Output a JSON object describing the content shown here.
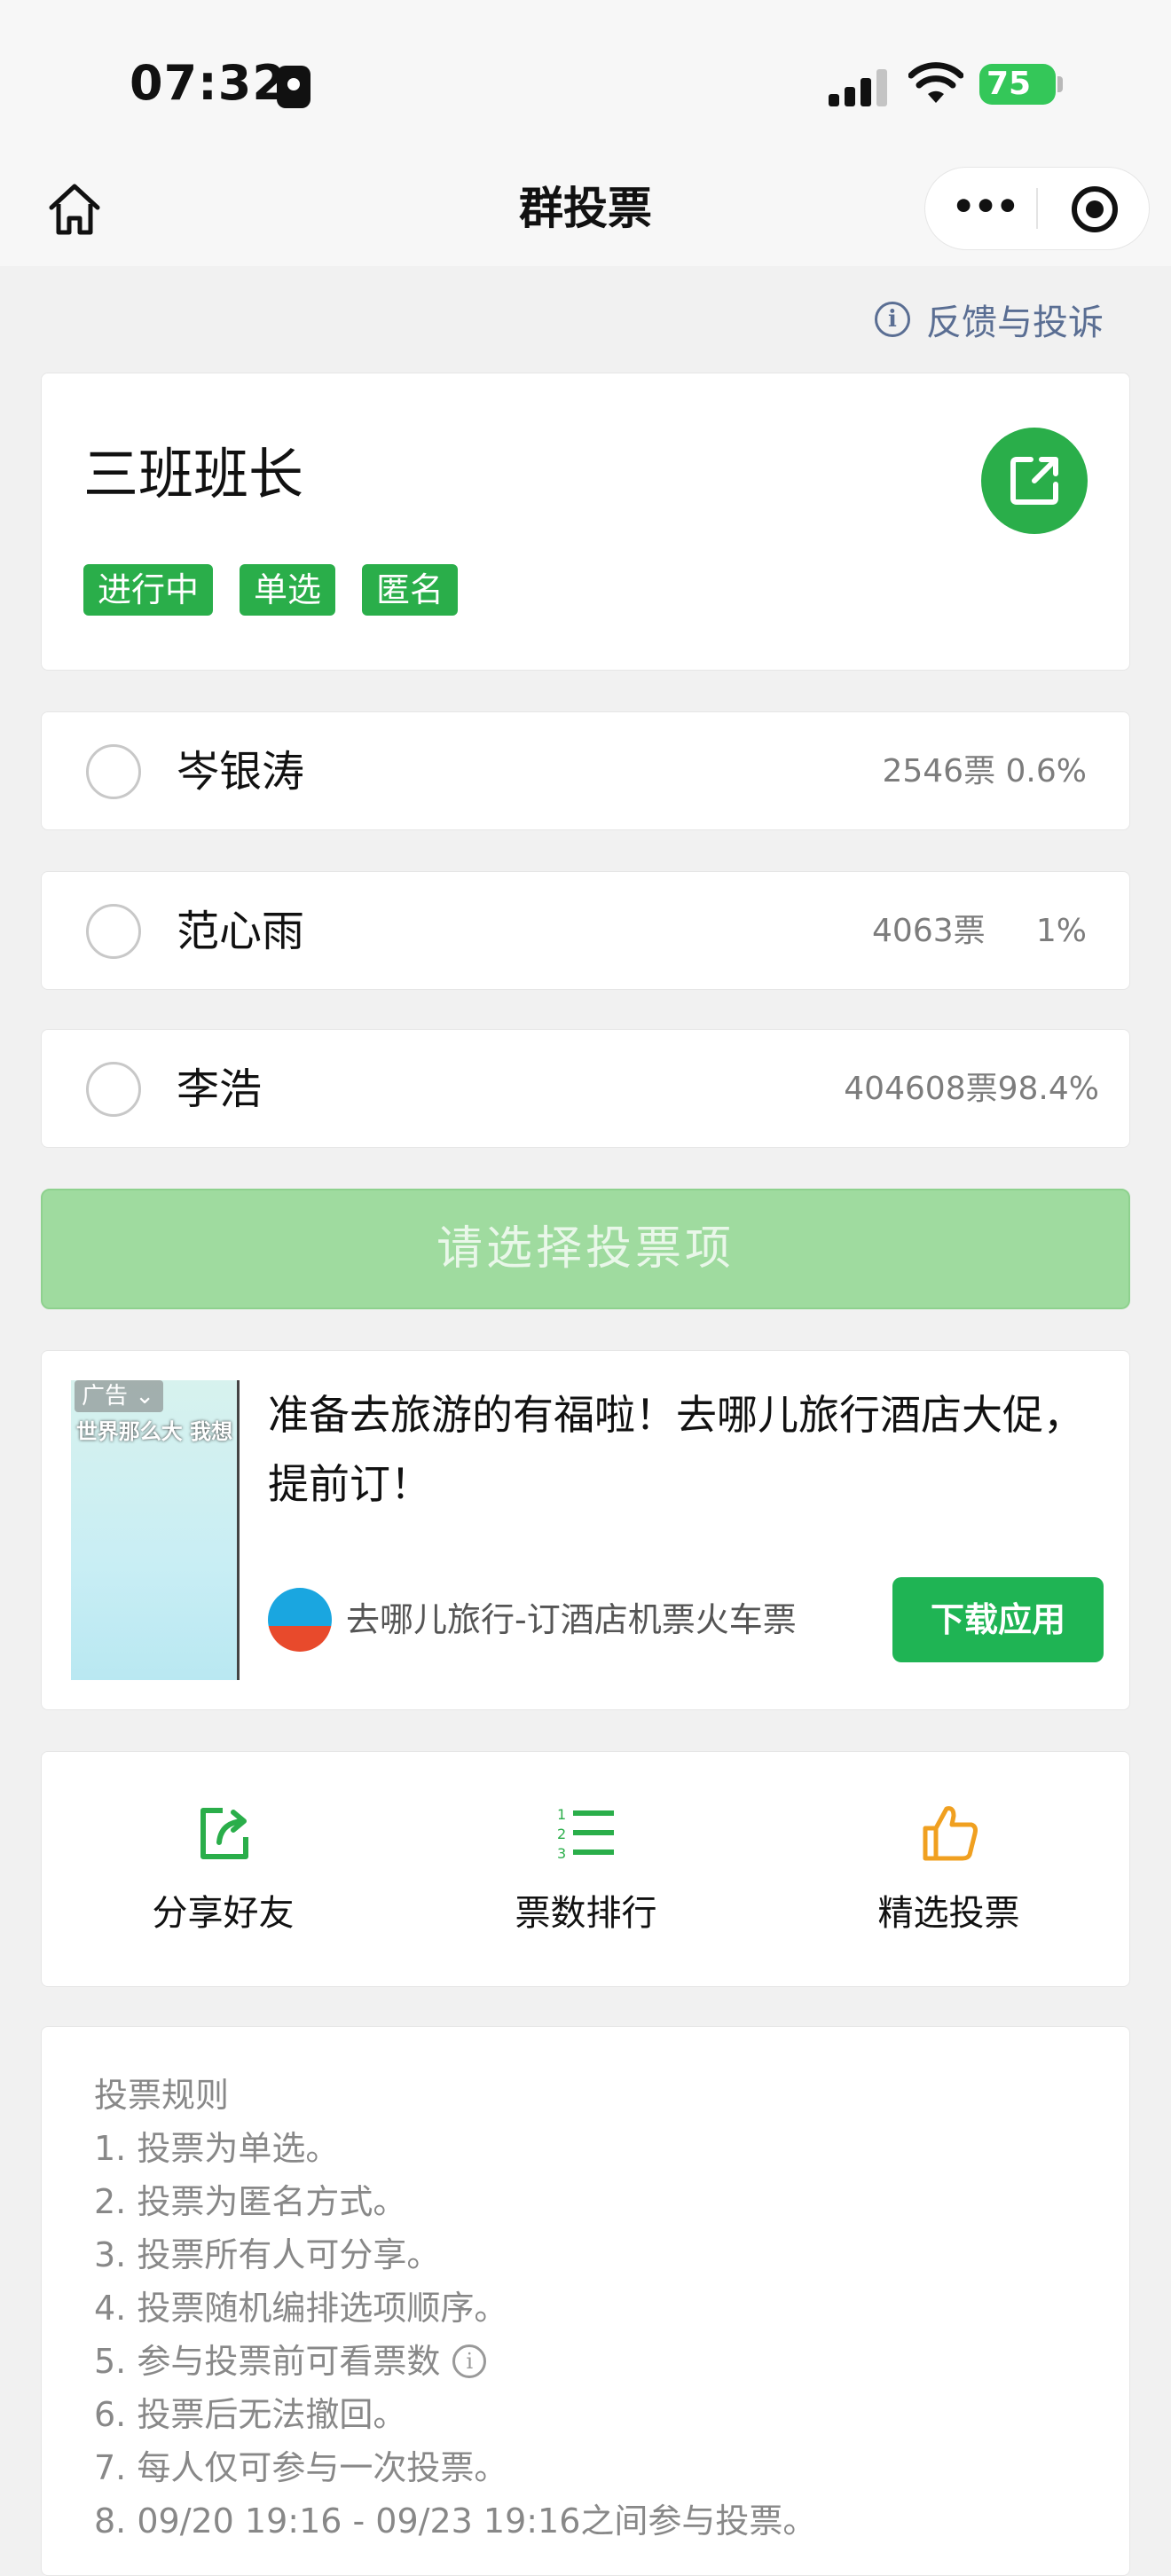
{
  "status_bar": {
    "time": "07:32",
    "battery": "75"
  },
  "nav": {
    "title": "群投票"
  },
  "feedback": {
    "label": "反馈与投诉"
  },
  "poll": {
    "title": "三班班长",
    "tags": [
      "进行中",
      "单选",
      "匿名"
    ]
  },
  "options": [
    {
      "name": "岑银涛",
      "votes": "2546票",
      "percent": "0.6%"
    },
    {
      "name": "范心雨",
      "votes": "4063票",
      "percent": "1%"
    },
    {
      "name": "李浩",
      "votes": "404608票",
      "percent": "98.4%"
    }
  ],
  "submit": {
    "label": "请选择投票项"
  },
  "ad": {
    "badge": "广告",
    "thumb_text": "世界那么大 我想",
    "headline": "准备去旅游的有福啦！去哪儿旅行酒店大促，提前订！",
    "source": "去哪儿旅行-订酒店机票火车票",
    "cta": "下载应用"
  },
  "actions": [
    {
      "label": "分享好友",
      "icon": "share-icon"
    },
    {
      "label": "票数排行",
      "icon": "ranking-list-icon"
    },
    {
      "label": "精选投票",
      "icon": "thumbs-up-icon"
    }
  ],
  "rules": {
    "heading": "投票规则",
    "items": [
      "1. 投票为单选。",
      "2. 投票为匿名方式。",
      "3. 投票所有人可分享。",
      "4. 投票随机编排选项顺序。",
      "5. 参与投票前可看票数",
      "6. 投票后无法撤回。",
      "7. 每人仅可参与一次投票。",
      "8. 09/20 19:16 - 09/23 19:16之间参与投票。"
    ]
  },
  "colors": {
    "accent": "#2aae4a",
    "submit_disabled": "#9fdb9f",
    "link": "#5a6e93",
    "thumbs": "#f0a020"
  }
}
